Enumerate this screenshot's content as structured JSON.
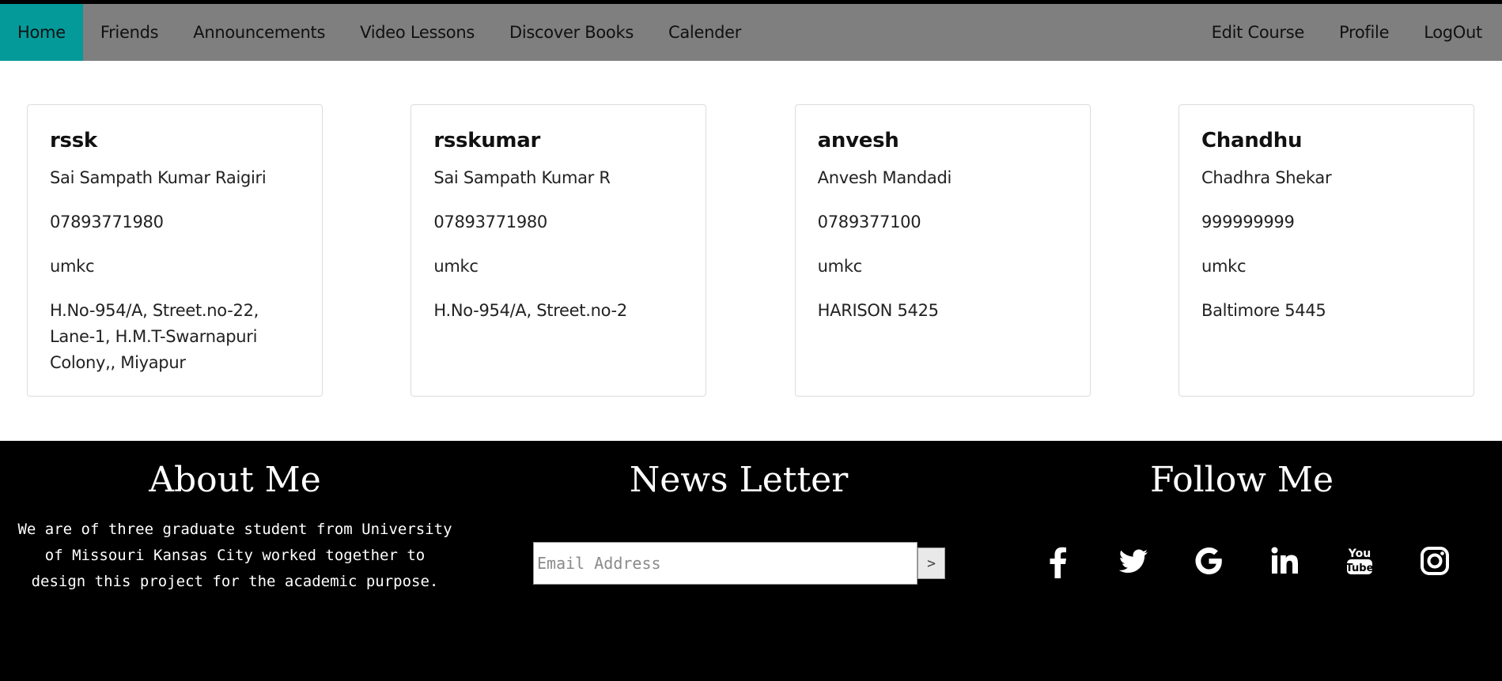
{
  "nav": {
    "left": [
      {
        "label": "Home",
        "active": true
      },
      {
        "label": "Friends"
      },
      {
        "label": "Announcements"
      },
      {
        "label": "Video Lessons"
      },
      {
        "label": "Discover Books"
      },
      {
        "label": "Calender"
      }
    ],
    "right": [
      {
        "label": "Edit Course"
      },
      {
        "label": "Profile"
      },
      {
        "label": "LogOut"
      }
    ],
    "active_color": "#049a9a",
    "bar_color": "#7f7f7f"
  },
  "friends": [
    {
      "username": "rssk",
      "full_name": "Sai Sampath Kumar Raigiri",
      "phone": "07893771980",
      "university": "umkc",
      "address": "H.No-954/A, Street.no-22, Lane-1, H.M.T-Swarnapuri Colony,, Miyapur"
    },
    {
      "username": "rsskumar",
      "full_name": "Sai Sampath Kumar R",
      "phone": "07893771980",
      "university": "umkc",
      "address": "H.No-954/A, Street.no-2"
    },
    {
      "username": "anvesh",
      "full_name": "Anvesh Mandadi",
      "phone": "0789377100",
      "university": "umkc",
      "address": "HARISON 5425"
    },
    {
      "username": "Chandhu",
      "full_name": "Chadhra Shekar",
      "phone": "999999999",
      "university": "umkc",
      "address": "Baltimore 5445"
    }
  ],
  "footer": {
    "about": {
      "title": "About Me",
      "text": "We are of three graduate student from University of Missouri Kansas City worked together to design this project for the academic purpose."
    },
    "newsletter": {
      "title": "News Letter",
      "email_placeholder": "Email Address",
      "email_value": "",
      "submit_label": ">"
    },
    "follow": {
      "title": "Follow Me",
      "icons": [
        "facebook-icon",
        "twitter-icon",
        "google-icon",
        "linkedin-icon",
        "youtube-icon",
        "instagram-icon"
      ]
    }
  }
}
